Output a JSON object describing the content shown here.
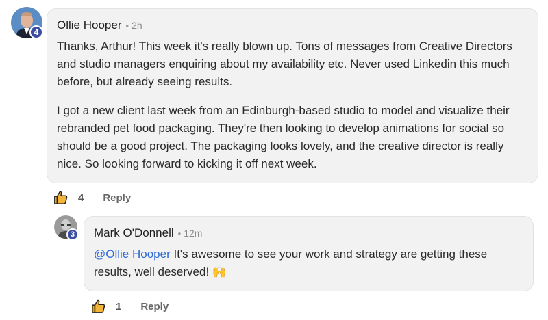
{
  "comment": {
    "author": "Ollie Hooper",
    "time": "2h",
    "badge": "4",
    "paragraphs": [
      "Thanks, Arthur! This week it's really blown up. Tons of messages from Creative Directors and studio managers enquiring about my availability etc. Never used Linkedin this much before, but already seeing results.",
      "I got a new client last week from an Edinburgh-based studio to model and visualize their rebranded pet food packaging. They're then looking to develop animations for social so should be a good project. The packaging looks lovely, and the creative director is really nice. So looking forward to kicking it off next week."
    ],
    "likes": "4",
    "reply_label": "Reply"
  },
  "reply": {
    "author": "Mark O'Donnell",
    "time": "12m",
    "badge": "3",
    "mention": "@Ollie Hooper",
    "text": " It's awesome to see your work and strategy are getting these results, well deserved! 🙌",
    "likes": "1",
    "reply_label": "Reply"
  },
  "colors": {
    "badge": "#3c4fa3",
    "mention": "#2d6ad6",
    "bubble": "#f2f2f2",
    "like_icon": "#e8a317"
  }
}
